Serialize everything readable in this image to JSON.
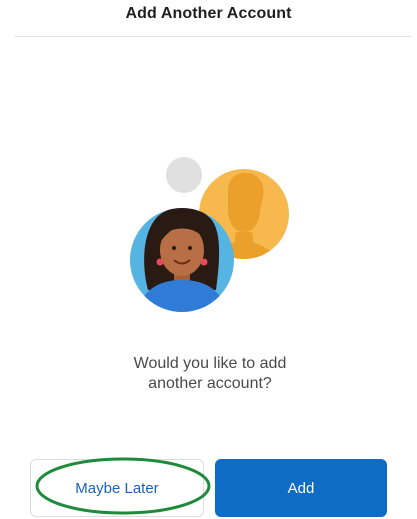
{
  "header": {
    "title": "Add Another Account"
  },
  "illustration": {
    "icon": "add-account-people-illustration",
    "colors": {
      "front_bg": "#56b4e3",
      "back_bg": "#f7b94d",
      "back_figure": "#eaa02b",
      "small_dot": "#e0e0e0",
      "skin": "#b86f45",
      "hair": "#2a1a14",
      "shirt": "#2f7bd6",
      "earring": "#e64a5a"
    }
  },
  "prompt": {
    "line1": "Would you like to add",
    "line2": "another account?"
  },
  "buttons": {
    "maybe_later": "Maybe Later",
    "add": "Add"
  },
  "annotation": {
    "highlight_color": "#1f8a3a"
  }
}
